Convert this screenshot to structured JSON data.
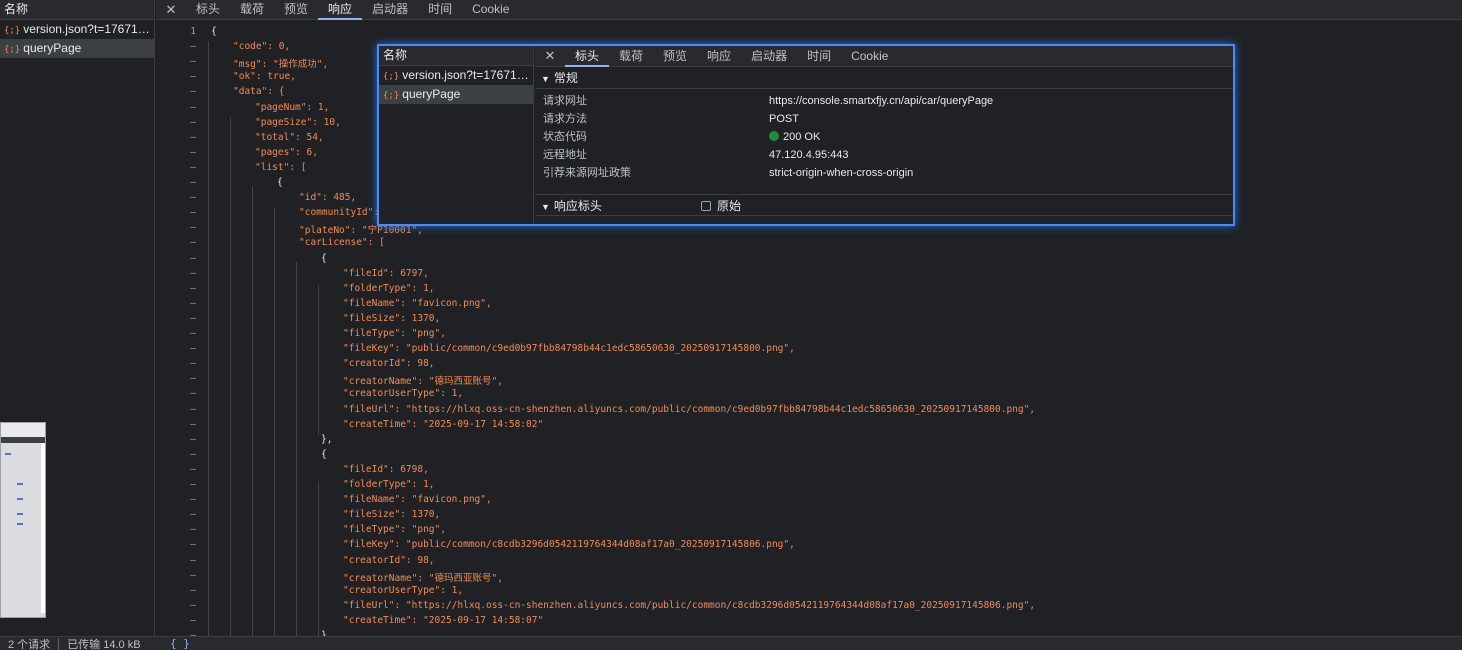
{
  "left_panel": {
    "header": "名称",
    "requests": [
      {
        "icon": "{;}",
        "name": "version.json?t=176714..."
      },
      {
        "icon": "{;}",
        "name": "queryPage"
      }
    ]
  },
  "tabs": {
    "close": "✕",
    "items": [
      "标头",
      "载荷",
      "预览",
      "响应",
      "启动器",
      "时间",
      "Cookie"
    ],
    "active": "响应"
  },
  "code": {
    "line_numbers": [
      "1",
      "–",
      "–",
      "–",
      "–",
      "–",
      "–",
      "–",
      "–",
      "–",
      "–",
      "–",
      "–",
      "–",
      "–",
      "–",
      "–",
      "–",
      "–",
      "–",
      "–",
      "–",
      "–",
      "–",
      "–",
      "–",
      "–",
      "–",
      "–",
      "–",
      "–",
      "–",
      "–",
      "–",
      "–",
      "–",
      "–",
      "–",
      "–",
      "–",
      "–",
      "–"
    ],
    "lines": [
      "{",
      "\"code\": 0,",
      "\"msg\": \"操作成功\",",
      "\"ok\": true,",
      "\"data\": {",
      "\"pageNum\": 1,",
      "\"pageSize\": 10,",
      "\"total\": 54,",
      "\"pages\": 6,",
      "\"list\": [",
      "{",
      "\"id\": 485,",
      "\"communityId\":",
      "\"plateNo\": \"宁P10001\",",
      "\"carLicense\": [",
      "{",
      "\"fileId\": 6797,",
      "\"folderType\": 1,",
      "\"fileName\": \"favicon.png\",",
      "\"fileSize\": 1370,",
      "\"fileType\": \"png\",",
      "\"fileKey\": \"public/common/c9ed0b97fbb84798b44c1edc58650630_20250917145800.png\",",
      "\"creatorId\": 98,",
      "\"creatorName\": \"德玛西亚账号\",",
      "\"creatorUserType\": 1,",
      "\"fileUrl\": \"https://hlxq.oss-cn-shenzhen.aliyuncs.com/public/common/c9ed0b97fbb84798b44c1edc58650630_20250917145800.png\",",
      "\"createTime\": \"2025-09-17 14:58:02\"",
      "},",
      "{",
      "\"fileId\": 6798,",
      "\"folderType\": 1,",
      "\"fileName\": \"favicon.png\",",
      "\"fileSize\": 1370,",
      "\"fileType\": \"png\",",
      "\"fileKey\": \"public/common/c8cdb3296d0542119764344d08af17a0_20250917145806.png\",",
      "\"creatorId\": 98,",
      "\"creatorName\": \"德玛西亚账号\",",
      "\"creatorUserType\": 1,",
      "\"fileUrl\": \"https://hlxq.oss-cn-shenzhen.aliyuncs.com/public/common/c8cdb3296d0542119764344d08af17a0_20250917145806.png\",",
      "\"createTime\": \"2025-09-17 14:58:07\"",
      "}"
    ]
  },
  "status": {
    "requests": "2 个请求",
    "transferred": "已传输 14.0 kB",
    "format_icon": "{ }"
  },
  "popup": {
    "header": "名称",
    "requests": [
      {
        "icon": "{;}",
        "name": "version.json?t=176714..."
      },
      {
        "icon": "{;}",
        "name": "queryPage"
      }
    ],
    "tabs": [
      "标头",
      "载荷",
      "预览",
      "响应",
      "启动器",
      "时间",
      "Cookie"
    ],
    "active_tab": "标头",
    "general": {
      "title": "常规",
      "rows": [
        {
          "label": "请求网址",
          "value": "https://console.smartxfjy.cn/api/car/queryPage"
        },
        {
          "label": "请求方法",
          "value": "POST"
        },
        {
          "label": "状态代码",
          "value": "200 OK"
        },
        {
          "label": "远程地址",
          "value": "47.120.4.95:443"
        },
        {
          "label": "引荐来源网址政策",
          "value": "strict-origin-when-cross-origin"
        }
      ]
    },
    "response_headers": {
      "title": "响应标头",
      "raw_label": "原始"
    },
    "status_color": "#1e8e3e"
  }
}
